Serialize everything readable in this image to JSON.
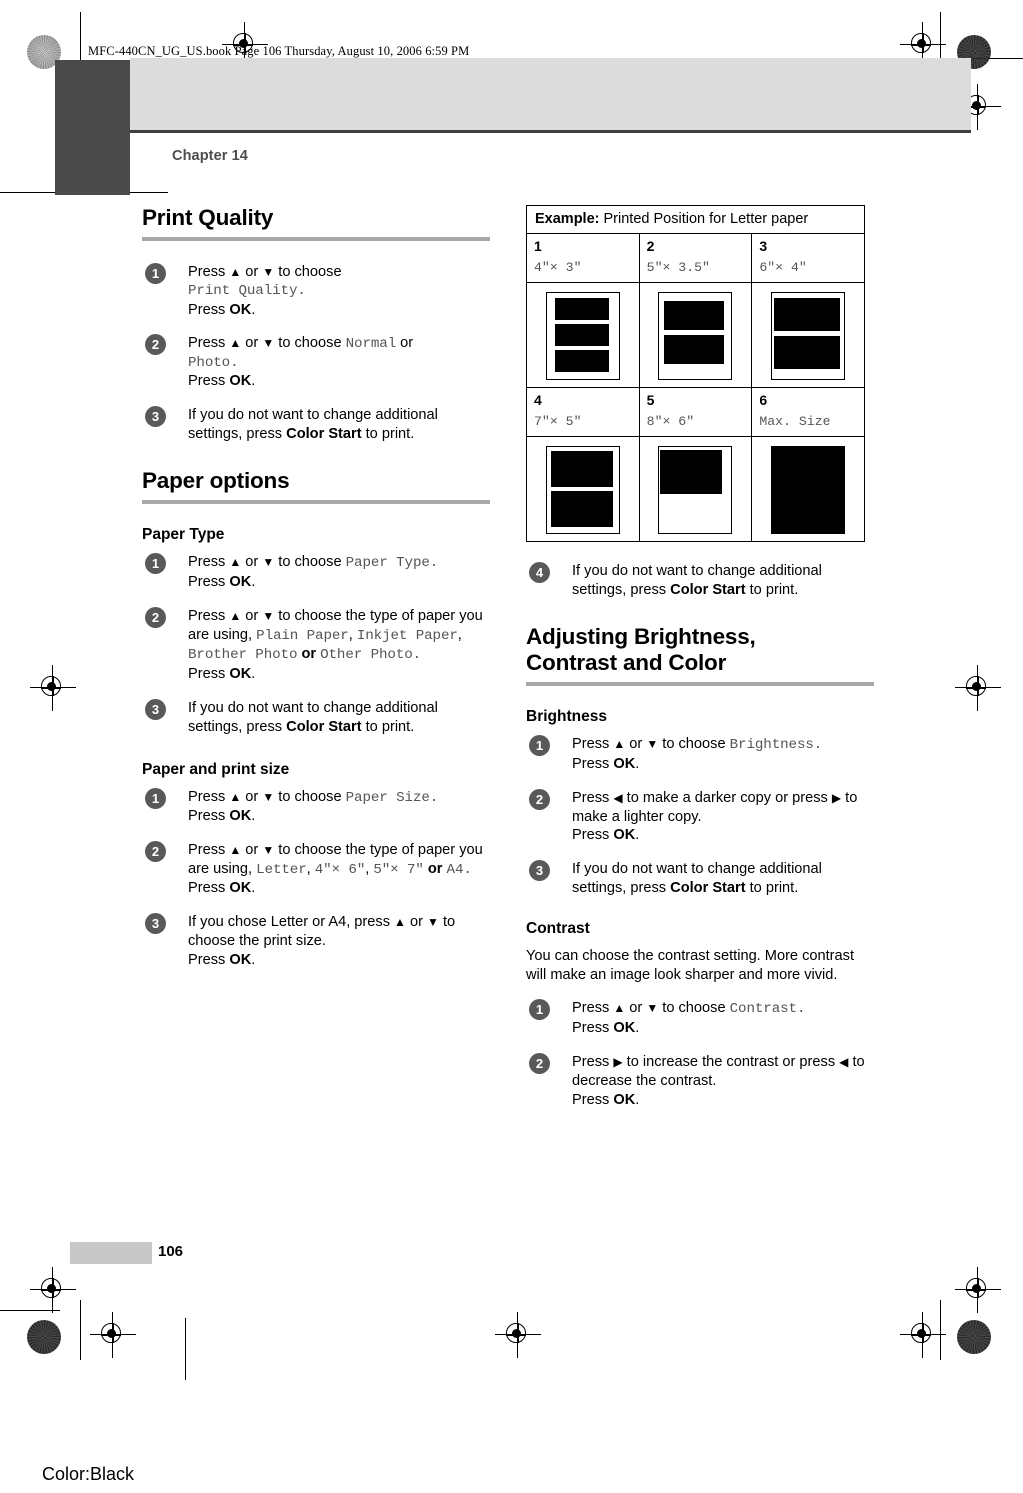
{
  "header": {
    "file_line": "MFC-440CN_UG_US.book  Page 106  Thursday, August 10, 2006  6:59 PM",
    "chapter": "Chapter 14"
  },
  "footer": {
    "page_number": "106",
    "color_note": "Color:Black"
  },
  "left_column": {
    "print_quality": {
      "heading": "Print Quality",
      "steps": [
        {
          "num": "1",
          "l1_a": "Press ",
          "l1_up": "▲",
          "l1_b": " or ",
          "l1_dn": "▼",
          "l1_c": " to choose",
          "l2_mono": "Print Quality.",
          "l3_a": "Press ",
          "l3_b": "OK",
          "l3_c": "."
        },
        {
          "num": "2",
          "l1_a": "Press ",
          "l1_up": "▲",
          "l1_b": " or ",
          "l1_dn": "▼",
          "l1_c": " to choose ",
          "l1_mono": "Normal",
          "l1_d": " or",
          "l2_mono": "Photo.",
          "l3_a": "Press ",
          "l3_b": "OK",
          "l3_c": "."
        },
        {
          "num": "3",
          "l1_a": "If you do not want to change additional settings, press ",
          "l1_b": "Color Start",
          "l1_c": " to print."
        }
      ]
    },
    "paper_options": {
      "heading": "Paper options",
      "paper_type": {
        "heading": "Paper Type",
        "steps": [
          {
            "num": "1",
            "l1_a": "Press ",
            "l1_up": "▲",
            "l1_b": " or ",
            "l1_dn": "▼",
            "l1_c": " to choose ",
            "l1_mono": "Paper Type.",
            "l3_a": "Press ",
            "l3_b": "OK",
            "l3_c": "."
          },
          {
            "num": "2",
            "l1_a": "Press ",
            "l1_up": "▲",
            "l1_b": " or ",
            "l1_dn": "▼",
            "l1_c": " to choose the type of paper you are using, ",
            "m1": "Plain Paper",
            "sep1": ", ",
            "m2": "Inkjet Paper",
            "sep2": ", ",
            "m3": "Brother Photo",
            "sep3": " or ",
            "m4": "Other Photo",
            "sep4": ".",
            "l3_a": "Press ",
            "l3_b": "OK",
            "l3_c": "."
          },
          {
            "num": "3",
            "l1_a": "If you do not want to change additional settings, press ",
            "l1_b": "Color Start",
            "l1_c": " to print."
          }
        ]
      },
      "paper_and_print_size": {
        "heading": "Paper and print size",
        "steps": [
          {
            "num": "1",
            "l1_a": "Press ",
            "l1_up": "▲",
            "l1_b": " or ",
            "l1_dn": "▼",
            "l1_c": " to choose ",
            "l1_mono": "Paper Size.",
            "l3_a": "Press ",
            "l3_b": "OK",
            "l3_c": "."
          },
          {
            "num": "2",
            "l1_a": "Press ",
            "l1_up": "▲",
            "l1_b": " or ",
            "l1_dn": "▼",
            "l1_c": " to choose the type of paper you are using, ",
            "m1": "Letter",
            "sep1": ", ",
            "m2": "4\"× 6\"",
            "sep2": ", ",
            "m3": "5\"× 7\"",
            "sep3": " or ",
            "m4": "A4",
            "sep4": ".",
            "l3_a": "Press ",
            "l3_b": "OK",
            "l3_c": "."
          },
          {
            "num": "3",
            "l1_a": "If you chose Letter or A4, press ",
            "l1_up": "▲",
            "l1_b": " or ",
            "l1_dn": "▼",
            "l1_c": " to choose the print size.",
            "l3_a": "Press ",
            "l3_b": "OK",
            "l3_c": "."
          }
        ]
      }
    }
  },
  "right_column": {
    "example_table": {
      "caption_bold": "Example:",
      "caption_rest": " Printed Position for Letter paper",
      "cells": [
        {
          "num": "1",
          "dim": "4\"× 3\""
        },
        {
          "num": "2",
          "dim": "5\"× 3.5\""
        },
        {
          "num": "3",
          "dim": "6\"× 4\""
        },
        {
          "num": "4",
          "dim": "7\"× 5\""
        },
        {
          "num": "5",
          "dim": "8\"× 6\""
        },
        {
          "num": "6",
          "dim": "Max. Size"
        }
      ]
    },
    "step4": {
      "num": "4",
      "l1_a": "If you do not want to change additional settings, press ",
      "l1_b": "Color Start",
      "l1_c": " to print."
    },
    "adjusting": {
      "heading_line1": "Adjusting Brightness,",
      "heading_line2": "Contrast and Color",
      "brightness": {
        "heading": "Brightness",
        "steps": [
          {
            "num": "1",
            "l1_a": "Press ",
            "l1_up": "▲",
            "l1_b": " or ",
            "l1_dn": "▼",
            "l1_c": " to choose ",
            "l1_mono": "Brightness.",
            "l3_a": "Press ",
            "l3_b": "OK",
            "l3_c": "."
          },
          {
            "num": "2",
            "l1_a": "Press ",
            "l1_left": "◀",
            "l1_b": " to make a darker copy or press ",
            "l1_right": "▶",
            "l1_c": " to make a lighter copy.",
            "l3_a": "Press ",
            "l3_b": "OK",
            "l3_c": "."
          },
          {
            "num": "3",
            "l1_a": "If you do not want to change additional settings, press ",
            "l1_b": "Color Start",
            "l1_c": " to print."
          }
        ]
      },
      "contrast": {
        "heading": "Contrast",
        "intro": "You can choose the contrast setting. More contrast will make an image look sharper and more vivid.",
        "steps": [
          {
            "num": "1",
            "l1_a": "Press ",
            "l1_up": "▲",
            "l1_b": " or ",
            "l1_dn": "▼",
            "l1_c": " to choose ",
            "l1_mono": "Contrast.",
            "l3_a": "Press ",
            "l3_b": "OK",
            "l3_c": "."
          },
          {
            "num": "2",
            "l1_a": "Press ",
            "l1_right": "▶",
            "l1_b": " to increase the contrast or press ",
            "l1_left": "◀",
            "l1_c": " to decrease the contrast.",
            "l3_a": "Press ",
            "l3_b": "OK",
            "l3_c": "."
          }
        ]
      }
    }
  }
}
